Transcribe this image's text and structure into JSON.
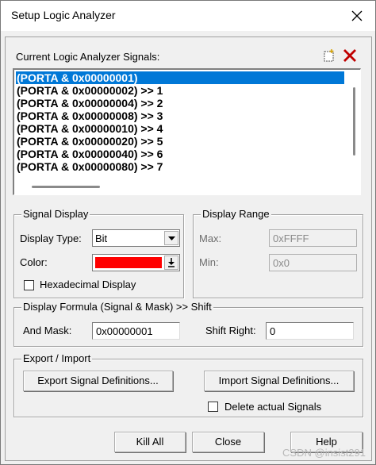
{
  "window": {
    "title": "Setup Logic Analyzer"
  },
  "signals": {
    "label": "Current Logic Analyzer Signals:",
    "items": [
      "(PORTA & 0x00000001)",
      "(PORTA & 0x00000002) >> 1",
      "(PORTA & 0x00000004) >> 2",
      "(PORTA & 0x00000008) >> 3",
      "(PORTA & 0x00000010) >> 4",
      "(PORTA & 0x00000020) >> 5",
      "(PORTA & 0x00000040) >> 6",
      "(PORTA & 0x00000080) >> 7"
    ],
    "selected_index": 0,
    "new_icon": "new-signal-icon",
    "delete_icon": "delete-signal-icon",
    "delete_color": "#c00000"
  },
  "signal_display": {
    "title": "Signal Display",
    "display_type_label": "Display Type:",
    "display_type_value": "Bit",
    "color_label": "Color:",
    "color_value": "#ff0000",
    "hex_label": "Hexadecimal Display",
    "hex_checked": false
  },
  "display_range": {
    "title": "Display Range",
    "max_label": "Max:",
    "max_value": "0xFFFF",
    "min_label": "Min:",
    "min_value": "0x0"
  },
  "formula": {
    "title": "Display Formula (Signal & Mask) >> Shift",
    "and_mask_label": "And Mask:",
    "and_mask_value": "0x00000001",
    "shift_right_label": "Shift Right:",
    "shift_right_value": "0"
  },
  "export_import": {
    "title": "Export / Import",
    "export_label": "Export Signal Definitions...",
    "import_label": "Import Signal Definitions...",
    "delete_actual_label": "Delete actual Signals",
    "delete_actual_checked": false
  },
  "footer": {
    "kill_all": "Kill All",
    "close": "Close",
    "help": "Help"
  },
  "watermark": "CSDN @insist291"
}
